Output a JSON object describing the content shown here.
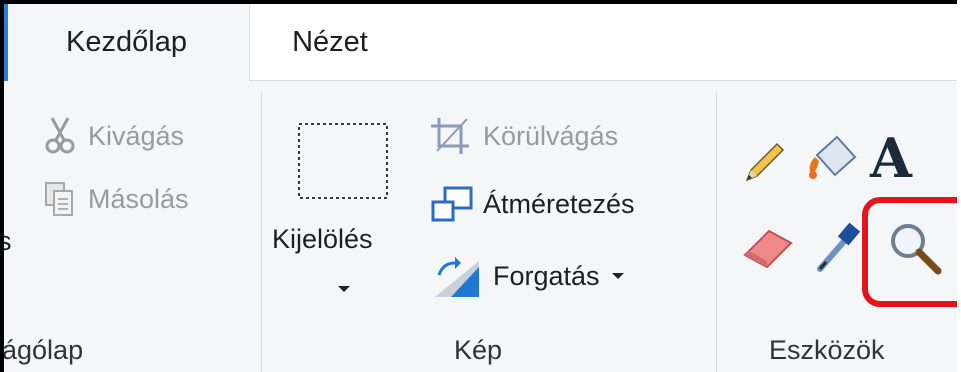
{
  "tabs": [
    {
      "label": "Kezdőlap",
      "active": true
    },
    {
      "label": "Nézet",
      "active": false
    }
  ],
  "clipboard": {
    "cut_label": "Kivágás",
    "copy_label": "Másolás",
    "paste_partial": "s",
    "group_label": "ágólap"
  },
  "image": {
    "select_label": "Kijelölés",
    "crop_label": "Körülvágás",
    "resize_label": "Átméretezés",
    "rotate_label": "Forgatás",
    "group_label": "Kép"
  },
  "tools": {
    "icons": [
      "pencil-icon",
      "fill-bucket-icon",
      "text-icon",
      "eraser-icon",
      "color-picker-icon",
      "magnifier-icon"
    ],
    "group_label": "Eszközök"
  },
  "colors": {
    "highlight": "#e5141b",
    "accent": "#2b7cd3"
  }
}
